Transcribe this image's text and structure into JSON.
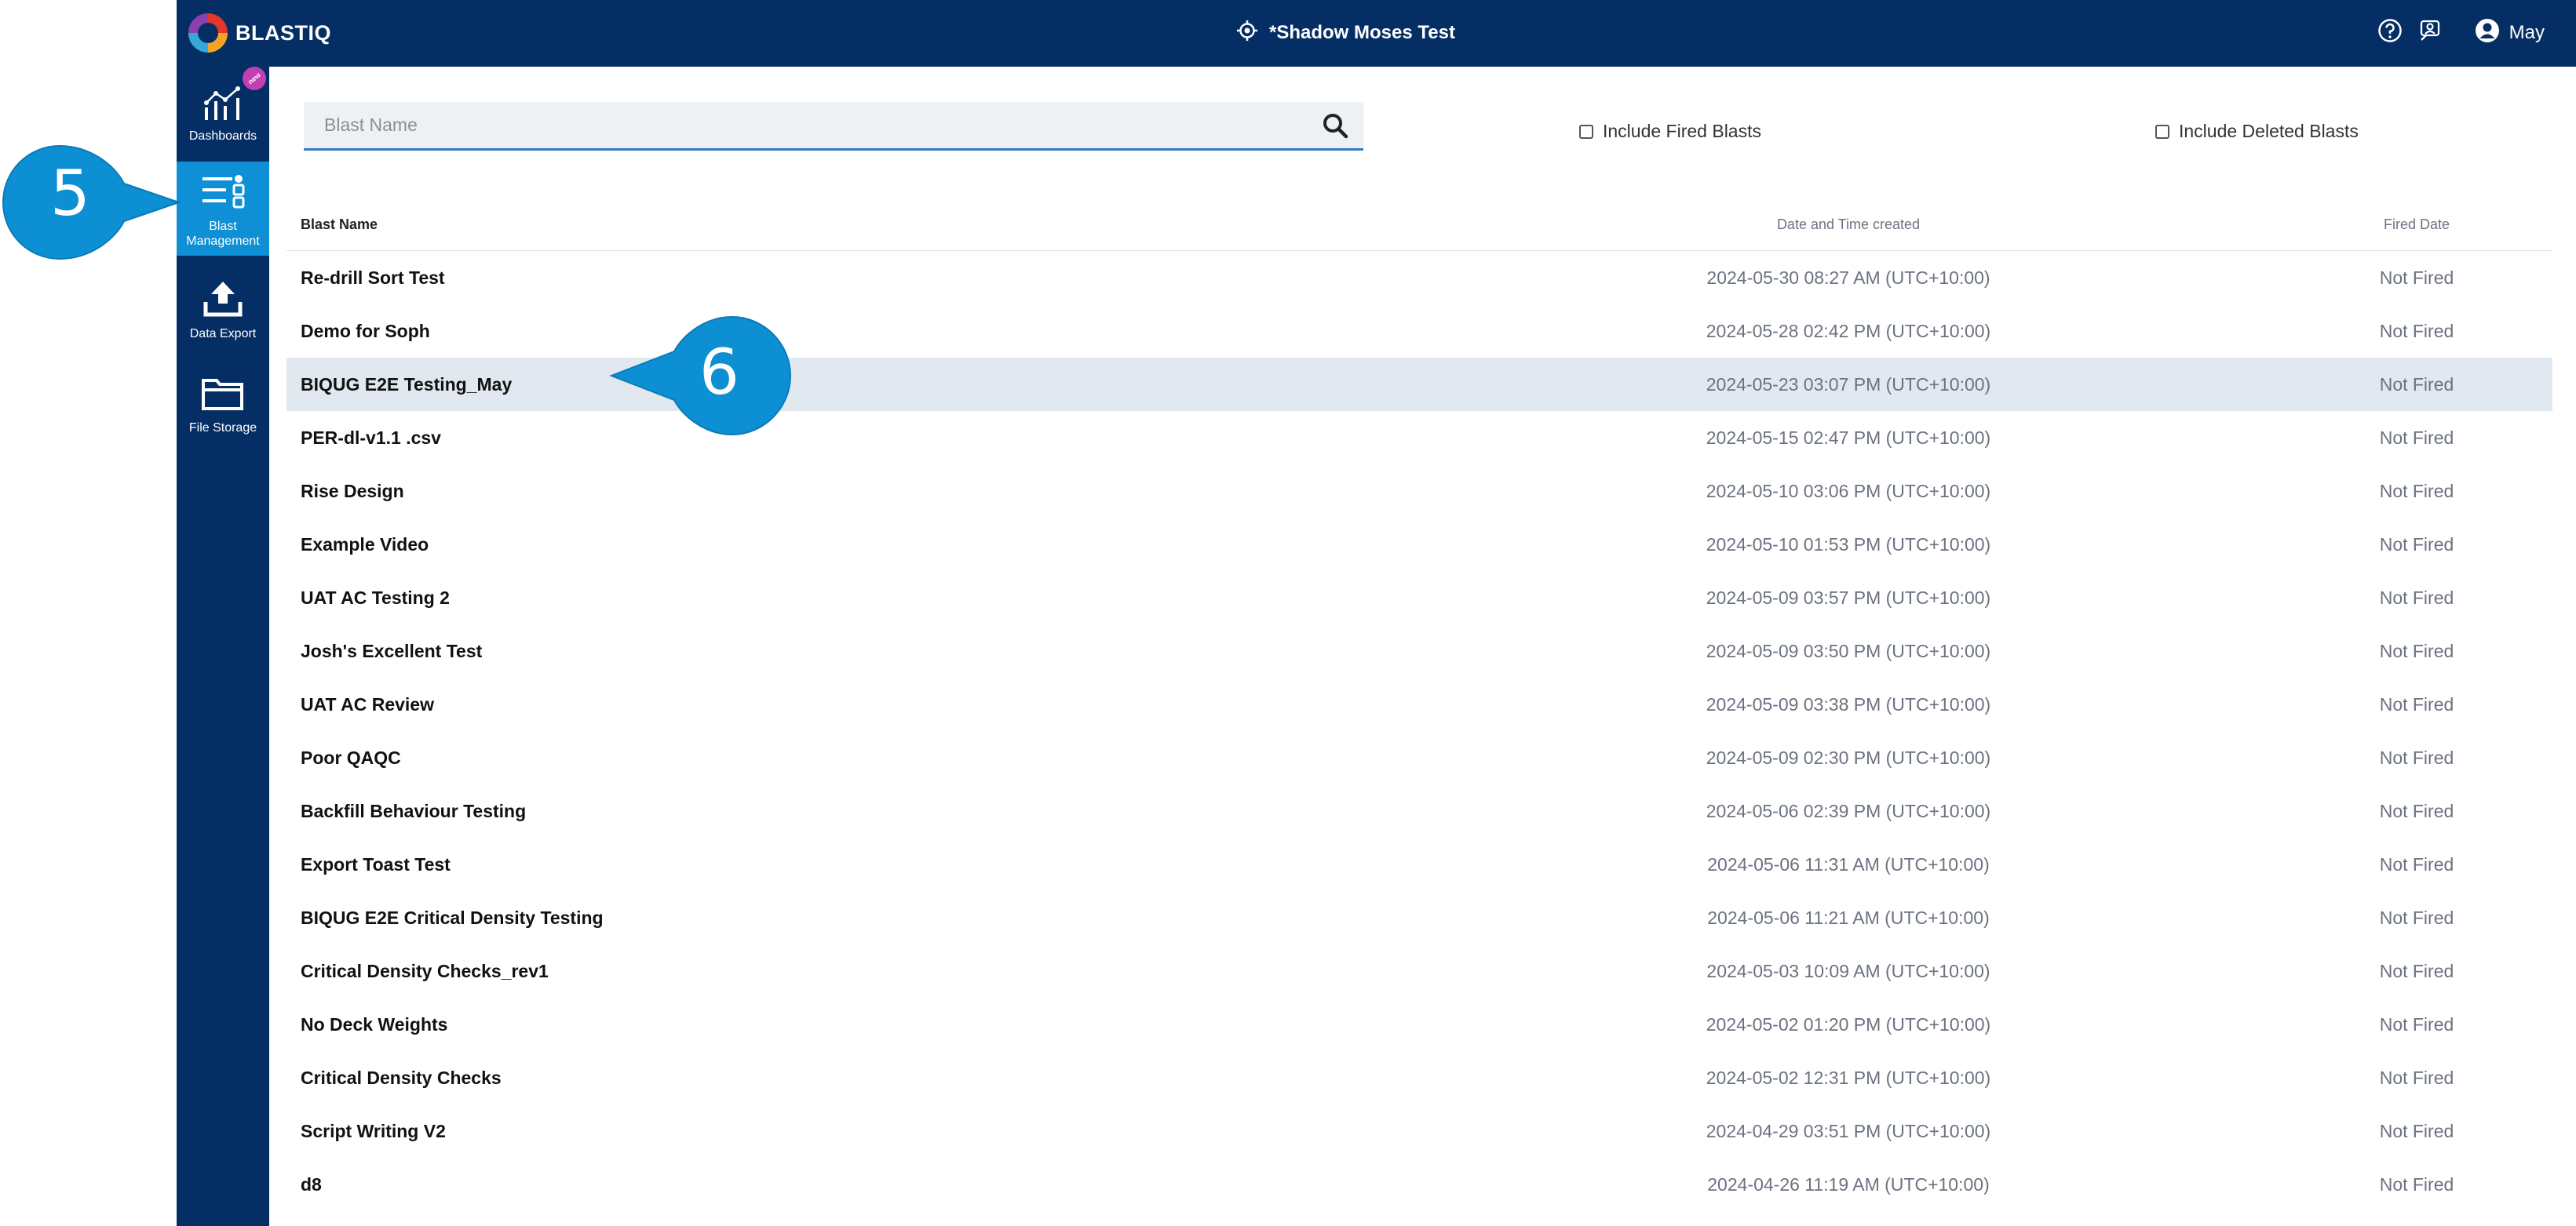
{
  "header": {
    "logo_text": "BLASTIQ",
    "project_name": "*Shadow Moses Test",
    "user_name": "May",
    "icons": [
      "help-icon",
      "support-icon",
      "account-icon",
      "location-target-icon"
    ]
  },
  "sidebar": {
    "items": [
      {
        "label": "Dashboards",
        "icon": "dashboard-chart-icon",
        "badge": "new",
        "active": false
      },
      {
        "label": "Blast Management",
        "icon": "blast-list-icon",
        "active": true
      },
      {
        "label": "Data Export",
        "icon": "upload-icon",
        "active": false
      },
      {
        "label": "File Storage",
        "icon": "folder-icon",
        "active": false
      }
    ]
  },
  "callouts": {
    "step_5": "5",
    "step_6": "6"
  },
  "search": {
    "placeholder": "Blast Name",
    "value": ""
  },
  "filters": {
    "include_fired": "Include Fired Blasts",
    "include_deleted": "Include Deleted Blasts"
  },
  "table": {
    "columns": {
      "name": "Blast Name",
      "date": "Date and Time created",
      "fired": "Fired Date"
    },
    "rows": [
      {
        "name": "Re-drill Sort Test",
        "date": "2024-05-30 08:27 AM (UTC+10:00)",
        "fired": "Not Fired"
      },
      {
        "name": "Demo for Soph",
        "date": "2024-05-28 02:42 PM (UTC+10:00)",
        "fired": "Not Fired"
      },
      {
        "name": "BIQUG E2E Testing_May",
        "date": "2024-05-23 03:07 PM (UTC+10:00)",
        "fired": "Not Fired"
      },
      {
        "name": "PER-dl-v1.1 .csv",
        "date": "2024-05-15 02:47 PM (UTC+10:00)",
        "fired": "Not Fired"
      },
      {
        "name": "Rise Design",
        "date": "2024-05-10 03:06 PM (UTC+10:00)",
        "fired": "Not Fired"
      },
      {
        "name": "Example Video",
        "date": "2024-05-10 01:53 PM (UTC+10:00)",
        "fired": "Not Fired"
      },
      {
        "name": "UAT AC Testing 2",
        "date": "2024-05-09 03:57 PM (UTC+10:00)",
        "fired": "Not Fired"
      },
      {
        "name": "Josh's Excellent Test",
        "date": "2024-05-09 03:50 PM (UTC+10:00)",
        "fired": "Not Fired"
      },
      {
        "name": "UAT AC Review",
        "date": "2024-05-09 03:38 PM (UTC+10:00)",
        "fired": "Not Fired"
      },
      {
        "name": "Poor QAQC",
        "date": "2024-05-09 02:30 PM (UTC+10:00)",
        "fired": "Not Fired"
      },
      {
        "name": "Backfill Behaviour Testing",
        "date": "2024-05-06 02:39 PM (UTC+10:00)",
        "fired": "Not Fired"
      },
      {
        "name": "Export Toast Test",
        "date": "2024-05-06 11:31 AM (UTC+10:00)",
        "fired": "Not Fired"
      },
      {
        "name": "BIQUG E2E Critical Density Testing",
        "date": "2024-05-06 11:21 AM (UTC+10:00)",
        "fired": "Not Fired"
      },
      {
        "name": "Critical Density Checks_rev1",
        "date": "2024-05-03 10:09 AM (UTC+10:00)",
        "fired": "Not Fired"
      },
      {
        "name": "No Deck Weights",
        "date": "2024-05-02 01:20 PM (UTC+10:00)",
        "fired": "Not Fired"
      },
      {
        "name": "Critical Density Checks",
        "date": "2024-05-02 12:31 PM (UTC+10:00)",
        "fired": "Not Fired"
      },
      {
        "name": "Script Writing V2",
        "date": "2024-04-29 03:51 PM (UTC+10:00)",
        "fired": "Not Fired"
      },
      {
        "name": "d8",
        "date": "2024-04-26 11:19 AM (UTC+10:00)",
        "fired": "Not Fired"
      }
    ],
    "highlighted_row": "BIQUG E2E Testing_May"
  },
  "colors": {
    "header_bg": "#052e64",
    "sidebar_active": "#0f8fd6",
    "callout": "#0d8fd3",
    "row_highlight": "#e1e8ef",
    "search_underline": "#2f7cc0"
  }
}
